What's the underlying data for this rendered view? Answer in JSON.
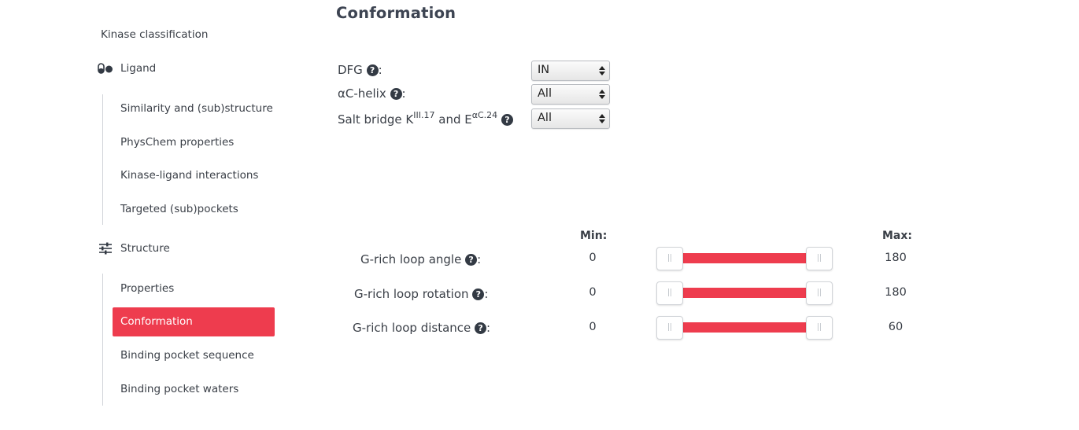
{
  "sidebar": {
    "top_item": "Kinase classification",
    "ligand": {
      "label": "Ligand",
      "items": [
        "Similarity and (sub)structure",
        "PhysChem properties",
        "Kinase-ligand interactions",
        "Targeted (sub)pockets"
      ]
    },
    "structure": {
      "label": "Structure",
      "items": [
        "Properties",
        "Conformation",
        "Binding pocket sequence",
        "Binding pocket waters"
      ]
    },
    "active_item": "Conformation"
  },
  "main": {
    "title": "Conformation",
    "selects": [
      {
        "label": "DFG",
        "value": "IN"
      },
      {
        "label": "αC-helix",
        "value": "All"
      },
      {
        "label_parts": [
          "Salt bridge K",
          "III.17",
          " and E",
          "αC.24"
        ],
        "value": "All"
      }
    ],
    "help_glyph": "?",
    "colon": ":",
    "sliders": {
      "min_header": "Min:",
      "max_header": "Max:",
      "rows": [
        {
          "label": "G-rich loop angle",
          "min": "0",
          "max": "180"
        },
        {
          "label": "G-rich loop rotation",
          "min": "0",
          "max": "180"
        },
        {
          "label": "G-rich loop distance",
          "min": "0",
          "max": "60"
        }
      ]
    }
  },
  "colors": {
    "accent": "#ee3c4e",
    "text": "#333a44"
  },
  "icons": {
    "ligand": "pills-icon",
    "structure": "sliders-icon",
    "help": "question-circle-icon",
    "select": "select-arrows-icon"
  }
}
